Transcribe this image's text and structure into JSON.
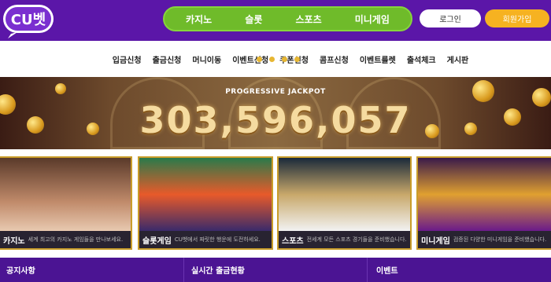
{
  "header": {
    "logo_text": "CU벳",
    "nav": [
      "카지노",
      "슬롯",
      "스포츠",
      "미니게임"
    ],
    "login_label": "로그인",
    "join_label": "회원가입"
  },
  "sub_nav": [
    "입금신청",
    "출금신청",
    "머니이동",
    "이벤트신청",
    "쿠폰신청",
    "콤프신청",
    "이벤트룰렛",
    "출석체크",
    "게시판"
  ],
  "jackpot": {
    "label": "PROGRESSIVE JACKPOT",
    "value": "303,596,057"
  },
  "cards": [
    {
      "title": "카지노",
      "desc": "세계 최고의 카지노 게임들을 만나보세요."
    },
    {
      "title": "슬롯게임",
      "desc": "CU벳에서 짜릿한 행운에 도전하세요."
    },
    {
      "title": "스포츠",
      "desc": "전세계 모든 스포츠 경기들을 준비했습니다."
    },
    {
      "title": "미니게임",
      "desc": "검증된 다양한 미니게임을 준비했습니다."
    }
  ],
  "bottom": {
    "notice": "공지사항",
    "withdraw": "실시간 출금현황",
    "event": "이벤트"
  },
  "colors": {
    "header_bg": "#5b16a8",
    "nav_green": "#6fbb2a",
    "join_orange": "#f6b221",
    "bottom_bg": "#4b1493",
    "gold": "#c99d2a"
  }
}
